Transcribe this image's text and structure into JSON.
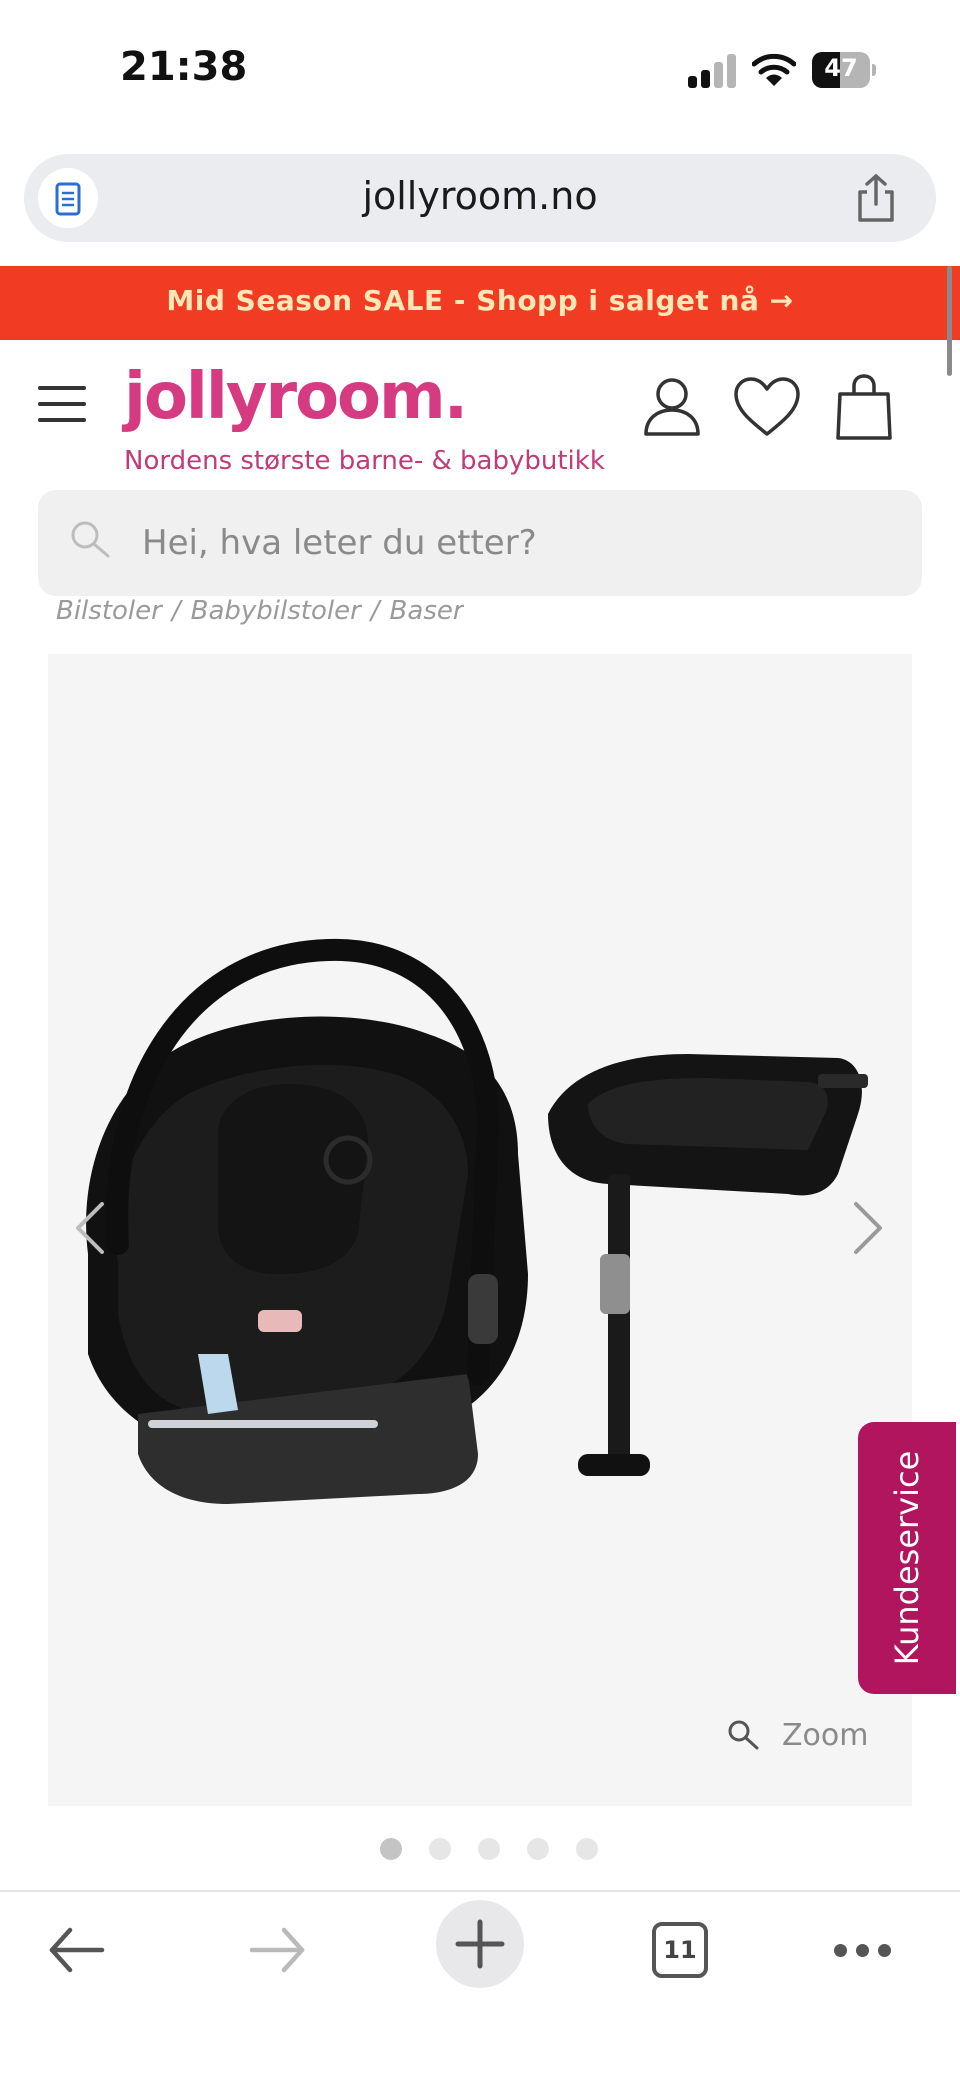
{
  "status_bar": {
    "time": "21:38",
    "battery": "47",
    "icons": [
      "signal-icon",
      "wifi-icon",
      "battery-icon"
    ]
  },
  "browser": {
    "url": "jollyroom.no",
    "icons": [
      "reader-icon",
      "share-icon"
    ]
  },
  "promo": {
    "text": "Mid Season SALE - Shopp i salget nå →"
  },
  "header": {
    "logo": "jollyroom.",
    "tagline": "Nordens største barne- & babybutikk",
    "icons": [
      "menu-icon",
      "account-icon",
      "heart-icon",
      "shopping-bag-icon"
    ]
  },
  "search": {
    "placeholder": "Hei, hva leter du etter?"
  },
  "breadcrumb": {
    "items": [
      "Bilstoler",
      "Babybilstoler",
      "Baser"
    ],
    "separator": "/"
  },
  "gallery": {
    "zoom_label": "Zoom",
    "slide_count": 5,
    "active_slide": 1
  },
  "support": {
    "label": "Kundeservice"
  },
  "toolbar": {
    "tab_count": "11",
    "icons": [
      "back-arrow-icon",
      "forward-arrow-icon",
      "plus-icon",
      "tabs-icon",
      "more-icon"
    ]
  },
  "colors": {
    "promo_bg": "#f13c23",
    "promo_text": "#fde7b6",
    "brand_pink": "#d63b82",
    "support_bg": "#b0155e"
  }
}
